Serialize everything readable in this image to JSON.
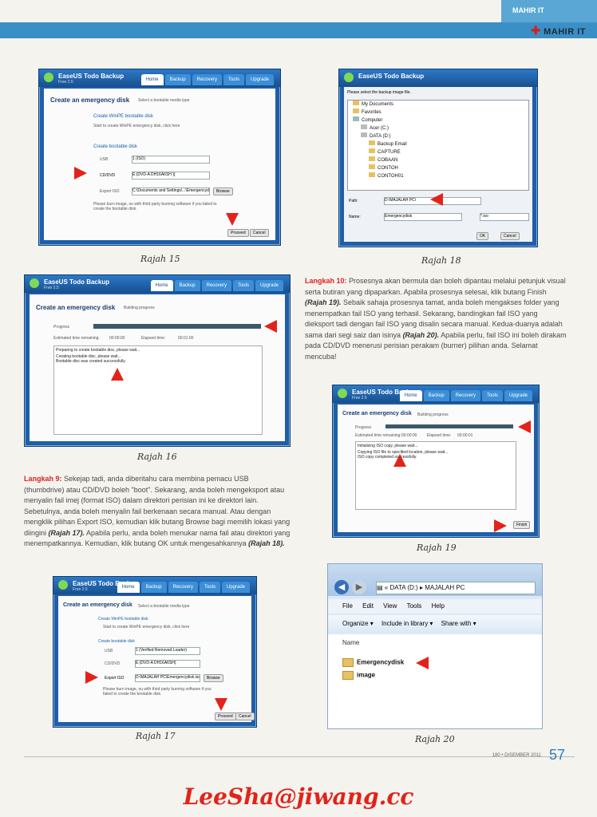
{
  "header": {
    "section_label": "MAHIR IT",
    "corner_label": "MAHIR IT"
  },
  "colors": {
    "accent_blue": "#3a8fc4",
    "accent_red": "#e2231a"
  },
  "screenshots": {
    "rajah15": {
      "app_title": "EaseUS Todo Backup",
      "app_version": "Free 2.5",
      "tabs": [
        "Home",
        "Backup",
        "Recovery",
        "Tools",
        "Upgrade"
      ],
      "page_title": "Create an emergency disk",
      "page_subtitle": "Select a bootable media type",
      "option1_title": "Create WinPE bootable disk",
      "option1_desc": "Start to create WinPE emergency disk, click here",
      "option2_title": "Create bootable disk",
      "usb_label": "USB",
      "usb_value": "1 (ISO)",
      "cddvd_label": "CD/DVD",
      "cddvd_value": "E:(DVD-A DH16A6SH )]",
      "export_label": "Export ISO",
      "export_value": "C:\\Documents and Settings\\...\\Emergencydisk.iso",
      "browse_label": "Browse",
      "note": "Please burn image, ou with third party burning software if you failed to create the bootable disk.",
      "proceed_label": "Proceed",
      "cancel_label": "Cancel"
    },
    "rajah16": {
      "app_title": "EaseUS Todo Backup",
      "app_version": "Free 2.5",
      "tabs": [
        "Home",
        "Backup",
        "Recovery",
        "Tools",
        "Upgrade"
      ],
      "page_title": "Create an emergency disk",
      "page_subtitle": "Building progress",
      "progress_label": "Progress",
      "progress_fraction": 1.0,
      "est_label": "Estimated time remaining:",
      "est_value": "00:00:00",
      "elapsed_label": "Elapsed time:",
      "elapsed_value": "00:01:00",
      "log": [
        "Preparing to create bootable disc, please wait...",
        "Creating bootable disc, please wait...",
        "Bootable disc was created successfully."
      ]
    },
    "rajah17": {
      "app_title": "EaseUS Todo Backup",
      "app_version": "Free 2.5",
      "tabs": [
        "Home",
        "Backup",
        "Recovery",
        "Tools",
        "Upgrade"
      ],
      "page_title": "Create an emergency disk",
      "page_subtitle": "Select a bootable media type",
      "option1_title": "Create WinPE bootable disk",
      "option1_desc": "Start to create WinPE emergency disk, click here",
      "option2_title": "Create bootable disk",
      "usb_label": "USB",
      "usb_value": "1 (Verified Removed Loader)",
      "cddvd_label": "CD/DVD",
      "cddvd_value": "E:(DVD-A DH16A6SH)",
      "export_label": "Export ISO",
      "export_value": "D:\\MAJALAH PC\\Emergencydisk.iso",
      "browse_label": "Browse",
      "note": "Please burn image, ou with third party burning software if you failed to create the bootable disk.",
      "proceed_label": "Proceed",
      "cancel_label": "Cancel"
    },
    "rajah18": {
      "app_title": "EaseUS Todo Backup",
      "prompt": "Please select the backup image file.",
      "tree": [
        "My Documents",
        "Favorites",
        "Computer",
        "Acer (C:)",
        "DATA (D:)",
        "Backup Email",
        "CAPTURE",
        "COBAAN",
        "CONTOH",
        "CONTOH01"
      ],
      "path_label": "Path:",
      "path_value": "D:\\MAJALAH PC\\",
      "name_label": "Name:",
      "name_value": "Emergencydisk",
      "ext_value": "*.iso",
      "ok_label": "OK",
      "cancel_label": "Cancel"
    },
    "rajah19": {
      "app_title": "EaseUS Todo Backup",
      "app_version": "Free 2.5",
      "tabs": [
        "Home",
        "Backup",
        "Recovery",
        "Tools",
        "Upgrade"
      ],
      "page_title": "Create an emergency disk",
      "page_subtitle": "Building progress",
      "progress_label": "Progress",
      "progress_fraction": 1.0,
      "est_label": "Estimated time remaining:",
      "est_value": "00:00:00",
      "elapsed_label": "Elapsed time:",
      "elapsed_value": "00:00:01",
      "log": [
        "Initializing ISO copy, please wait...",
        "Copying ISO file to specified location, please wait...",
        "ISO copy completed successfully."
      ],
      "finish_label": "Finish"
    },
    "rajah20": {
      "breadcrumb": [
        "DATA (D:)",
        "MAJALAH PC"
      ],
      "menu": [
        "File",
        "Edit",
        "View",
        "Tools",
        "Help"
      ],
      "toolbar": [
        "Organize",
        "Include in library",
        "Share with"
      ],
      "column_name": "Name",
      "items": [
        "Emergencydisk",
        "image"
      ]
    }
  },
  "captions": {
    "rajah15": "Rajah 15",
    "rajah16": "Rajah 16",
    "rajah17": "Rajah 17",
    "rajah18": "Rajah 18",
    "rajah19": "Rajah 19",
    "rajah20": "Rajah 20"
  },
  "langkah10": {
    "label": "Langkah 10:",
    "text_a": " Prosesnya akan bermula dan boleh dipantau melalui petunjuk visual serta butiran yang dipaparkan. Apabila prosesnya selesai, klik butang Finish ",
    "ref_a": "(Rajah 19).",
    "text_b": " Sebaik sahaja prosesnya tamat, anda boleh mengakses folder yang menempatkan fail ISO yang terhasil. Sekarang, bandingkan fail ISO yang dieksport tadi dengan fail ISO yang disalin secara manual. Kedua-duanya adalah sama dari segi saiz dan isinya ",
    "ref_b": "(Rajah 20).",
    "text_c": " Apabila perlu, fail ISO ini boleh dirakam pada CD/DVD menerusi perisian perakam (burner) pilihan anda. Selamat mencuba!"
  },
  "langkah9": {
    "label": "Langkah 9:",
    "text_a": " Sekejap tadi, anda diberitahu cara membina pemacu USB (thumbdrive) atau CD/DVD boleh \"boot\". Sekarang, anda boleh mengeksport atau menyalin fail imej (format ISO) dalam direktori perisian ini ke direktori lain. Sebetulnya, anda boleh menyalin fail berkenaan secara manual. Atau dengan mengklik pilihan Export ISO, kemudian klik butang Browse bagi memilih lokasi yang diingini ",
    "ref_a": "(Rajah 17).",
    "text_b": " Apabila perlu, anda boleh menukar nama fail atau direktori yang menempatkannya. Kemudian, klik butang OK untuk mengesahkannya ",
    "ref_b": "(Rajah 18)."
  },
  "footer": {
    "issue": "180 • DISEMBER 2011",
    "page_number": "57",
    "signature": "LeeSha@jiwang.cc"
  }
}
